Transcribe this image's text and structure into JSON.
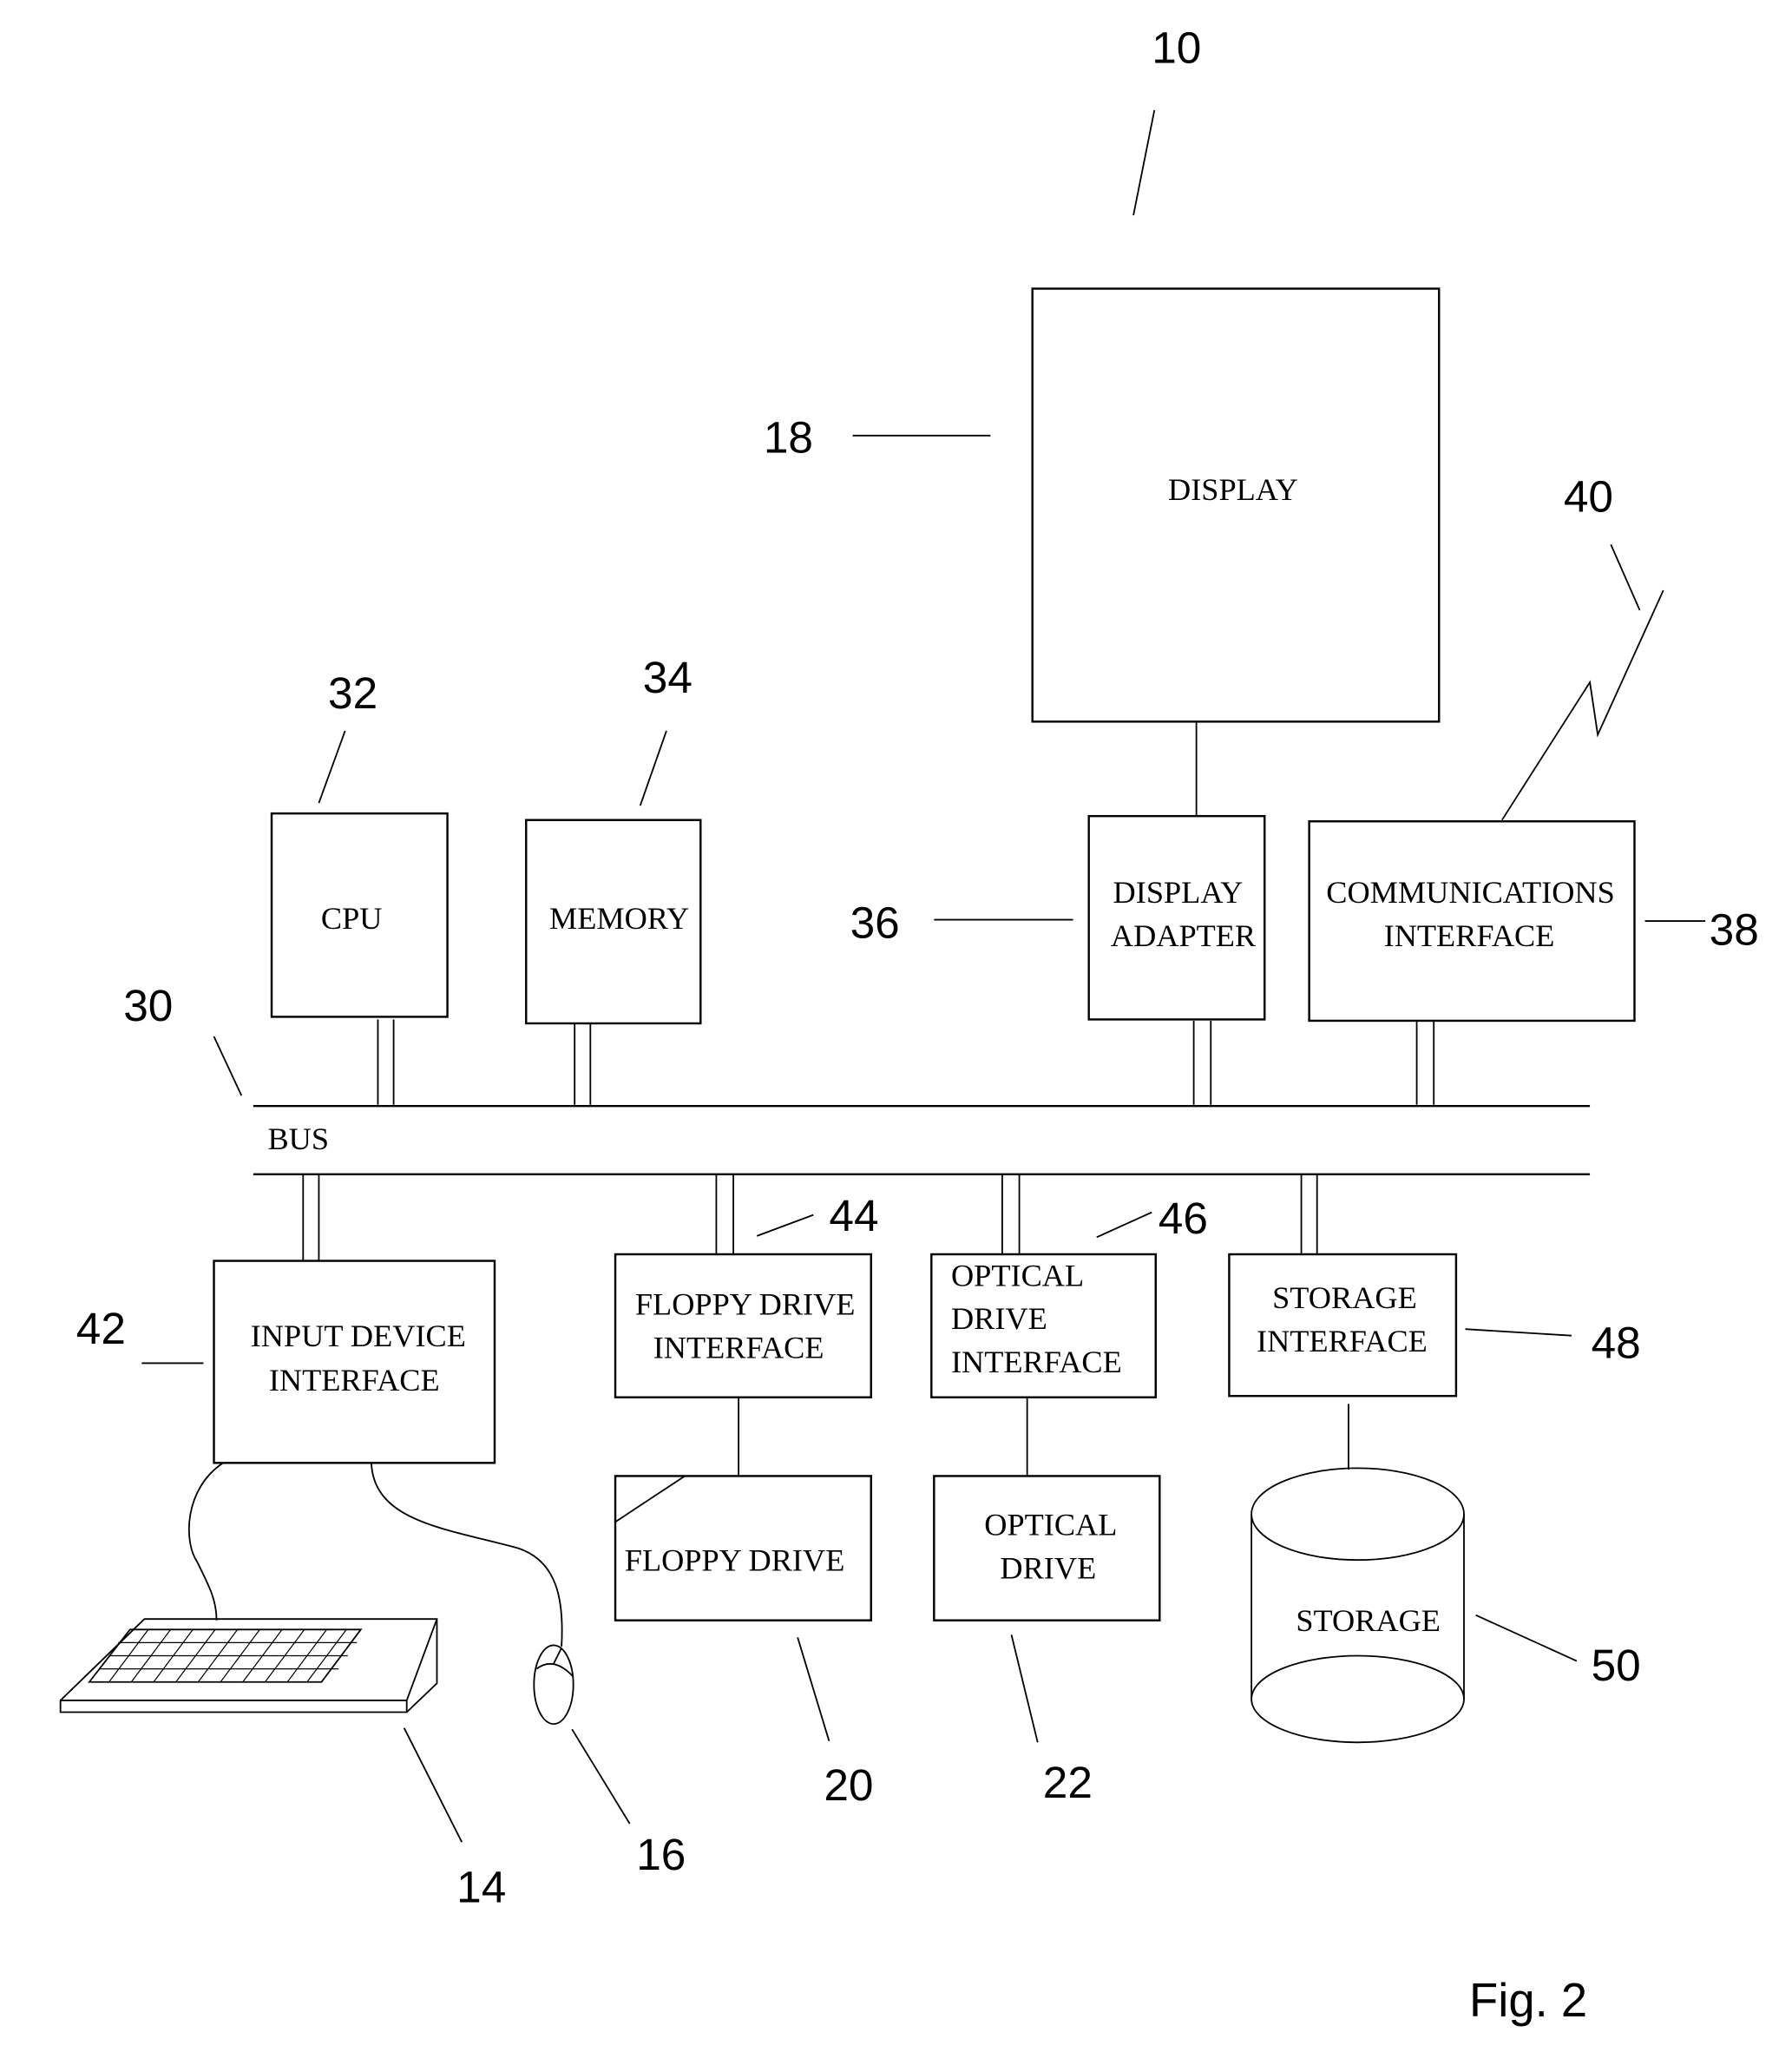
{
  "figure_label": "Fig. 2",
  "components": {
    "display": {
      "label": "DISPLAY",
      "ref": "18"
    },
    "display_adapter": {
      "line1": "DISPLAY",
      "line2": "ADAPTER",
      "ref": "36"
    },
    "communications_interface": {
      "line1": "COMMUNICATIONS",
      "line2": "INTERFACE",
      "ref": "38"
    },
    "cpu": {
      "label": "CPU",
      "ref": "32"
    },
    "memory": {
      "label": "MEMORY",
      "ref": "34"
    },
    "bus": {
      "label": "BUS",
      "ref": "30"
    },
    "input_device_interface": {
      "line1": "INPUT DEVICE",
      "line2": "INTERFACE",
      "ref": "42"
    },
    "floppy_drive_interface": {
      "line1": "FLOPPY DRIVE",
      "line2": "INTERFACE",
      "ref": "44"
    },
    "optical_drive_interface": {
      "line1": "OPTICAL",
      "line2": "DRIVE",
      "line3": "INTERFACE",
      "ref": "46"
    },
    "storage_interface": {
      "line1": "STORAGE",
      "line2": "INTERFACE",
      "ref": "48"
    },
    "floppy_drive": {
      "label": "FLOPPY DRIVE",
      "ref": "20"
    },
    "optical_drive": {
      "line1": "OPTICAL",
      "line2": "DRIVE",
      "ref": "22"
    },
    "storage": {
      "label": "STORAGE",
      "ref": "50"
    },
    "keyboard": {
      "ref": "14"
    },
    "mouse": {
      "ref": "16"
    },
    "network_link": {
      "ref": "40"
    },
    "system": {
      "ref": "10"
    }
  }
}
